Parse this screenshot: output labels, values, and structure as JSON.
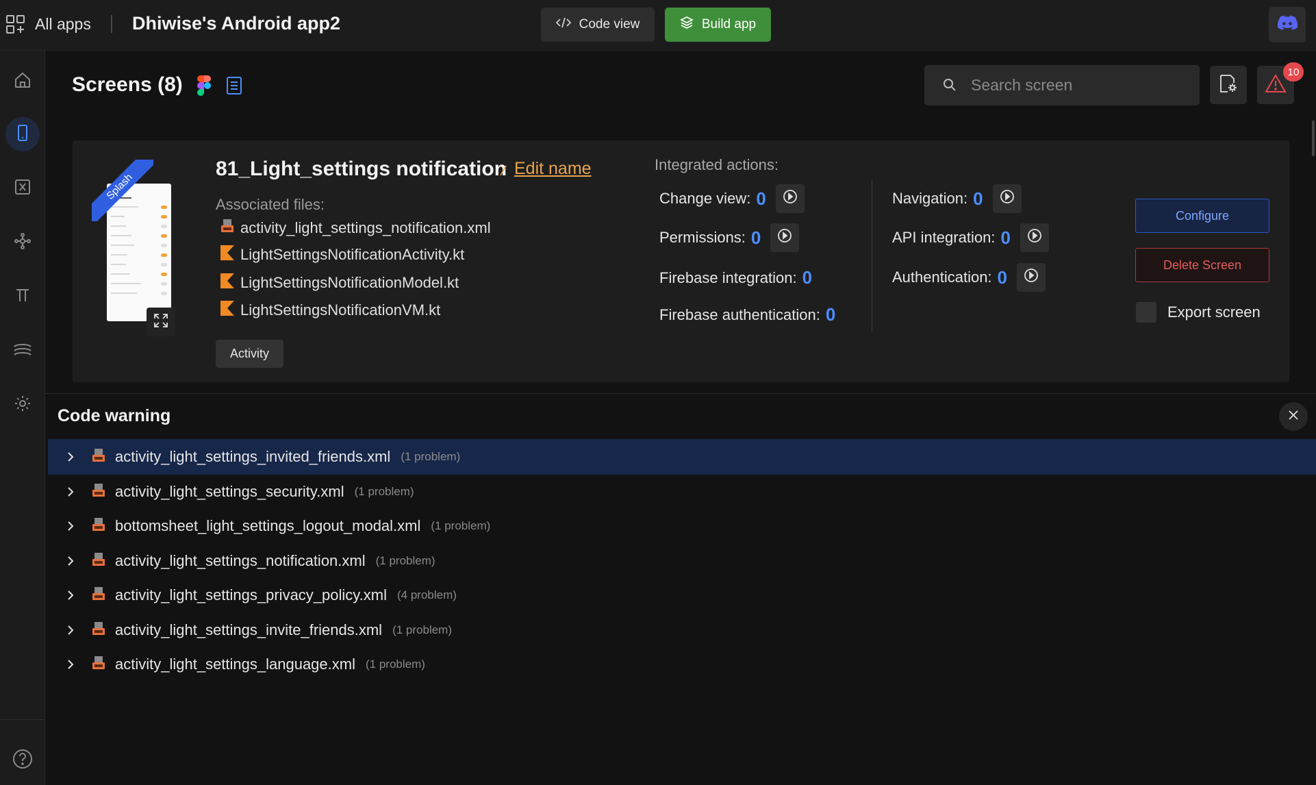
{
  "topbar": {
    "all_apps": "All apps",
    "project_title": "Dhiwise's Android app2",
    "code_view": "Code view",
    "build_app": "Build app",
    "discord_icon": "discord-icon"
  },
  "sidebar": {
    "items": [
      {
        "name": "home",
        "icon": "home-icon"
      },
      {
        "name": "screens",
        "icon": "phone-icon",
        "active": true
      },
      {
        "name": "variables",
        "icon": "function-icon"
      },
      {
        "name": "integrations",
        "icon": "network-icon"
      },
      {
        "name": "typography",
        "icon": "text-icon"
      },
      {
        "name": "styles",
        "icon": "layers-icon"
      },
      {
        "name": "settings",
        "icon": "gear-icon"
      },
      {
        "name": "help",
        "icon": "help-icon"
      }
    ]
  },
  "header": {
    "screens_title": "Screens (8)",
    "search_placeholder": "Search screen",
    "warning_count": "10"
  },
  "screen_card": {
    "ribbon": "Splash",
    "name": "81_Light_settings notification",
    "edit_name": "Edit name",
    "associated_label": "Associated files:",
    "files": [
      {
        "name": "activity_light_settings_notification.xml",
        "icon": "xml-file-icon"
      },
      {
        "name": "LightSettingsNotificationActivity.kt",
        "icon": "kotlin-file-icon"
      },
      {
        "name": "LightSettingsNotificationModel.kt",
        "icon": "kotlin-file-icon"
      },
      {
        "name": "LightSettingsNotificationVM.kt",
        "icon": "kotlin-file-icon"
      }
    ],
    "tag": "Activity",
    "integrated_label": "Integrated actions:",
    "actions_left": [
      {
        "label": "Change view:",
        "value": "0",
        "play": true
      },
      {
        "label": "Permissions:",
        "value": "0",
        "play": true
      },
      {
        "label": "Firebase integration:",
        "value": "0",
        "play": false
      },
      {
        "label": "Firebase authentication:",
        "value": "0",
        "play": false
      }
    ],
    "actions_right": [
      {
        "label": "Navigation:",
        "value": "0",
        "play": true
      },
      {
        "label": "API integration:",
        "value": "0",
        "play": true
      },
      {
        "label": "Authentication:",
        "value": "0",
        "play": true
      }
    ],
    "configure": "Configure",
    "delete": "Delete Screen",
    "export": "Export screen"
  },
  "code_warning": {
    "title": "Code warning",
    "rows": [
      {
        "file": "activity_light_settings_invited_friends.xml",
        "problems": "(1 problem)",
        "selected": true
      },
      {
        "file": "activity_light_settings_security.xml",
        "problems": "(1 problem)"
      },
      {
        "file": "bottomsheet_light_settings_logout_modal.xml",
        "problems": "(1 problem)"
      },
      {
        "file": "activity_light_settings_notification.xml",
        "problems": "(1 problem)"
      },
      {
        "file": "activity_light_settings_privacy_policy.xml",
        "problems": "(4 problem)"
      },
      {
        "file": "activity_light_settings_invite_friends.xml",
        "problems": "(1 problem)"
      },
      {
        "file": "activity_light_settings_language.xml",
        "problems": "(1 problem)"
      }
    ]
  },
  "colors": {
    "accent_blue": "#4c8dff",
    "build_green": "#3e8e3a",
    "edit_orange": "#e8a54d",
    "danger_red": "#e45c5c"
  }
}
